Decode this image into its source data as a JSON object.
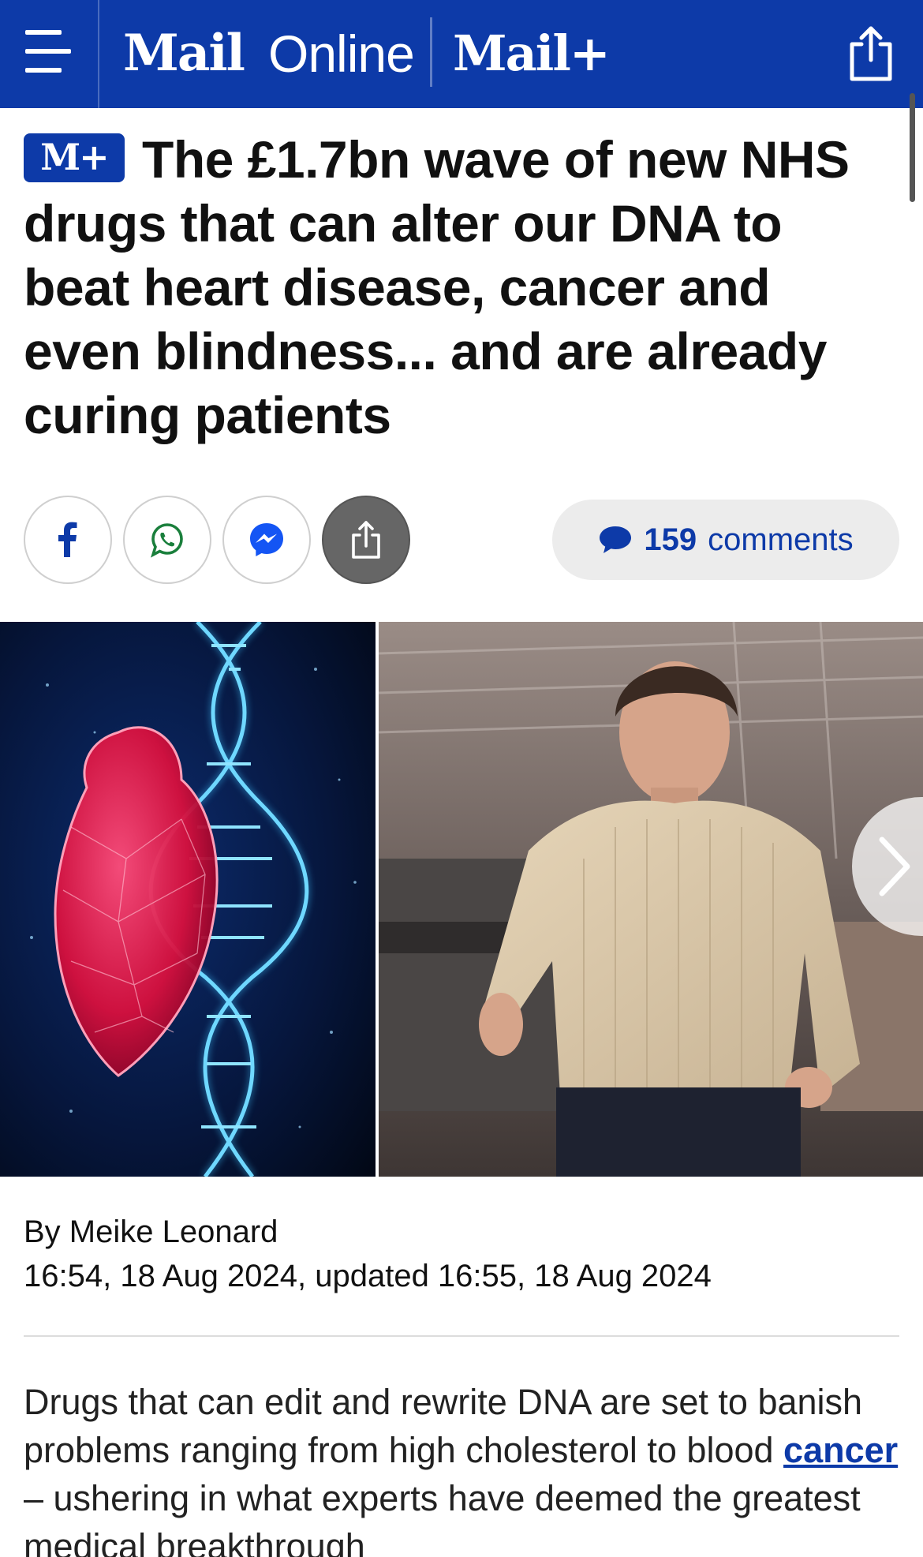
{
  "header": {
    "logo_mail": "Mail",
    "logo_online": "Online",
    "logo_mailplus": "Mail+",
    "brand_color": "#0d3aa8",
    "icons": [
      "menu-icon",
      "share-icon"
    ]
  },
  "article": {
    "badge": "M+",
    "headline": "The £1.7bn wave of new NHS drugs that can alter our DNA to beat heart disease, cancer and even blindness... and are already curing patients",
    "share": {
      "icons": [
        "facebook-icon",
        "whatsapp-icon",
        "messenger-icon",
        "share-icon"
      ]
    },
    "comments": {
      "count": "159",
      "label": "comments"
    },
    "byline": "By Meike Leonard",
    "dateline": "16:54, 18 Aug 2024, updated 16:55, 18 Aug 2024",
    "body": {
      "text_before": "Drugs that can edit and rewrite DNA are set to banish problems ranging from high cholesterol to blood ",
      "link": "cancer",
      "text_after": " – ushering in what experts have deemed the greatest medical breakthrough"
    }
  }
}
